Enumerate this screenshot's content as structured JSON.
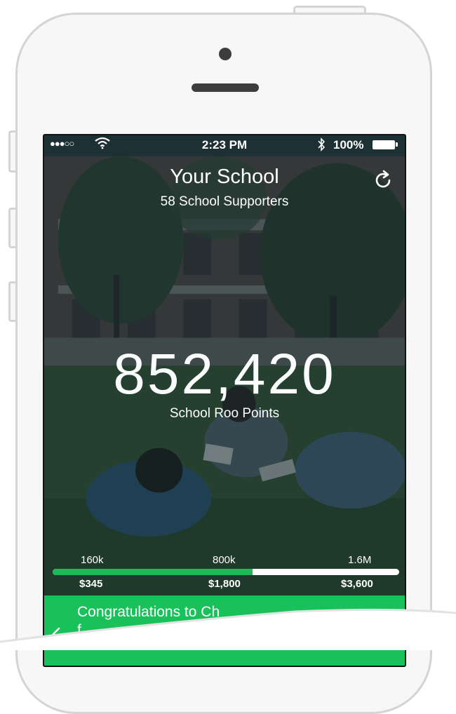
{
  "status_bar": {
    "signal": "●●●○○",
    "time": "2:23 PM",
    "battery": "100%"
  },
  "header": {
    "title": "Your School",
    "subtitle": "58 School Supporters",
    "refresh_icon": "refresh-icon"
  },
  "points": {
    "value": "852,420",
    "label": "School Roo Points"
  },
  "progress": {
    "fraction": 0.577,
    "milestones": [
      {
        "points": "160k",
        "dollars": "$345"
      },
      {
        "points": "800k",
        "dollars": "$1,800"
      },
      {
        "points": "1.6M",
        "dollars": "$3,600"
      }
    ]
  },
  "banner": {
    "text": "Congratulations to Ch",
    "text_hidden": "f",
    "back_icon": "chevron-left-icon"
  },
  "colors": {
    "accent_green": "#19c15a",
    "progress_green": "#22b85a"
  }
}
